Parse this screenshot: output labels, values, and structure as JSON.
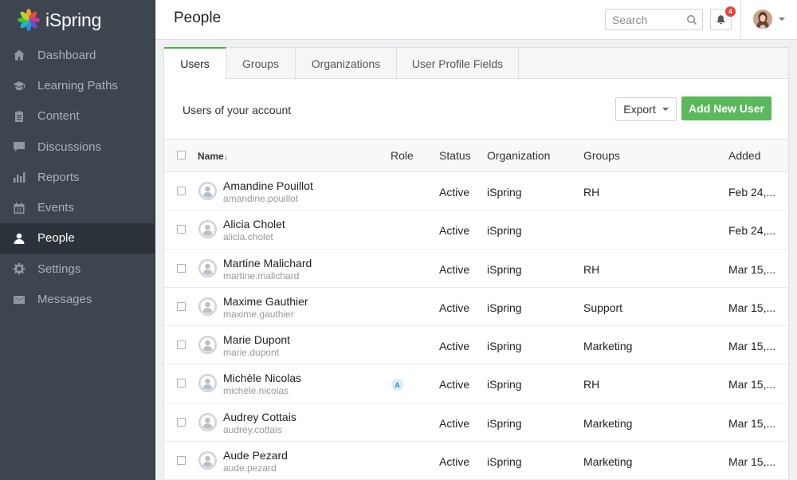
{
  "app": {
    "name": "iSpring"
  },
  "sidebar": {
    "items": [
      {
        "label": "Dashboard",
        "icon": "home-icon"
      },
      {
        "label": "Learning Paths",
        "icon": "graduation-cap-icon"
      },
      {
        "label": "Content",
        "icon": "clipboard-icon"
      },
      {
        "label": "Discussions",
        "icon": "chat-icon"
      },
      {
        "label": "Reports",
        "icon": "bar-chart-icon"
      },
      {
        "label": "Events",
        "icon": "calendar-icon"
      },
      {
        "label": "People",
        "icon": "user-icon",
        "active": true
      },
      {
        "label": "Settings",
        "icon": "gear-icon"
      },
      {
        "label": "Messages",
        "icon": "envelope-icon"
      }
    ]
  },
  "header": {
    "title": "People",
    "search_placeholder": "Search",
    "notification_count": "4"
  },
  "tabs": [
    {
      "label": "Users",
      "active": true
    },
    {
      "label": "Groups"
    },
    {
      "label": "Organizations"
    },
    {
      "label": "User Profile Fields"
    }
  ],
  "toolbar": {
    "title": "Users of your account",
    "export_label": "Export",
    "add_label": "Add New User"
  },
  "table": {
    "columns": {
      "name": "Name",
      "sort_indicator": "↓",
      "role": "Role",
      "status": "Status",
      "organization": "Organization",
      "groups": "Groups",
      "added": "Added"
    },
    "rows": [
      {
        "name": "Amandine Pouillot",
        "login": "amandine.pouillot",
        "role": "",
        "status": "Active",
        "organization": "iSpring",
        "groups": "RH",
        "added": "Feb 24,..."
      },
      {
        "name": "Alicia Cholet",
        "login": "alicia.cholet",
        "role": "",
        "status": "Active",
        "organization": "iSpring",
        "groups": "",
        "added": "Feb 24,..."
      },
      {
        "name": "Martine Malichard",
        "login": "martine.malichard",
        "role": "",
        "status": "Active",
        "organization": "iSpring",
        "groups": "RH",
        "added": "Mar 15,..."
      },
      {
        "name": "Maxime Gauthier",
        "login": "maxime.gauthier",
        "role": "",
        "status": "Active",
        "organization": "iSpring",
        "groups": "Support",
        "added": "Mar 15,..."
      },
      {
        "name": "Marie Dupont",
        "login": "marie.dupont",
        "role": "",
        "status": "Active",
        "organization": "iSpring",
        "groups": "Marketing",
        "added": "Mar 15,..."
      },
      {
        "name": "Michèle Nicolas",
        "login": "michèle.nicolas",
        "role": "A",
        "status": "Active",
        "organization": "iSpring",
        "groups": "RH",
        "added": "Mar 15,..."
      },
      {
        "name": "Audrey Cottais",
        "login": "audrey.cottais",
        "role": "",
        "status": "Active",
        "organization": "iSpring",
        "groups": "Marketing",
        "added": "Mar 15,..."
      },
      {
        "name": "Aude Pezard",
        "login": "aude.pezard",
        "role": "",
        "status": "Active",
        "organization": "iSpring",
        "groups": "Marketing",
        "added": "Mar 15,..."
      }
    ]
  },
  "colors": {
    "sidebar_bg": "#3d454f",
    "accent_green": "#5cb85c",
    "badge_red": "#e2463b"
  }
}
